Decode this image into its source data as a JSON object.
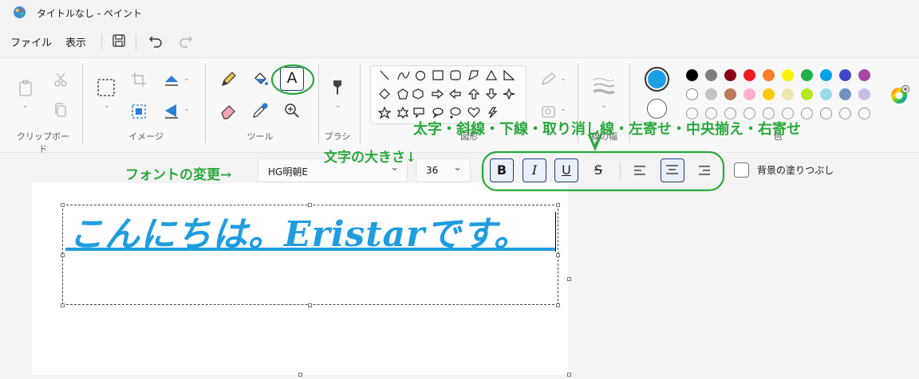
{
  "window": {
    "title": "タイトルなし - ペイント"
  },
  "menu": {
    "file": "ファイル",
    "view": "表示"
  },
  "quick_access": {
    "save_icon": "save-icon",
    "undo_icon": "undo-icon",
    "redo_icon": "redo-icon"
  },
  "ribbon": {
    "groups": {
      "clipboard": "クリップボード",
      "image": "イメージ",
      "tools": "ツール",
      "brush": "ブラシ",
      "shapes": "図形",
      "stroke": "線の幅",
      "colors": "色"
    },
    "text_tool_glyph": "A"
  },
  "colors": {
    "primary": "#1a9ee6",
    "secondary": "#ffffff",
    "palette_row1": [
      "#000000",
      "#7f7f7f",
      "#880015",
      "#ed1c24",
      "#ff7f27",
      "#fff200",
      "#22b14c",
      "#00a2e8",
      "#3f48cc",
      "#a349a4"
    ],
    "palette_row2": [
      "#ffffff",
      "#c3c3c3",
      "#b97a57",
      "#ffaec9",
      "#ffc90e",
      "#efe4b0",
      "#b5e61d",
      "#99d9ea",
      "#7092be",
      "#c8bfe7"
    ]
  },
  "text_toolbar": {
    "font_name": "HG明朝E",
    "font_size": "36",
    "bold": "B",
    "italic": "I",
    "underline": "U",
    "strike": "S",
    "fill_background_label": "背景の塗りつぶし"
  },
  "canvas": {
    "text": "こんにちは。Eristarです。"
  },
  "annotations": {
    "font_change": "フォントの変更→",
    "font_size": "文字の大きさ↓",
    "formatting": "太字・斜線・下線・取り消し線・左寄せ・中央揃え・右寄せ"
  }
}
